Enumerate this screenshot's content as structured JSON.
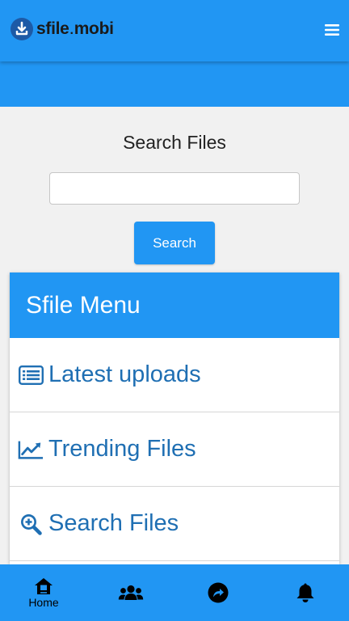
{
  "header": {
    "logo_name": "sfile",
    "logo_dot": ".",
    "logo_suffix": "mobi",
    "menu_icon": "hamburger-icon"
  },
  "search": {
    "title": "Search Files",
    "input_value": "",
    "button_label": "Search"
  },
  "menu": {
    "title": "Sfile Menu",
    "items": [
      {
        "label": "Latest uploads",
        "icon": "list-icon"
      },
      {
        "label": "Trending Files",
        "icon": "trending-chart-icon"
      },
      {
        "label": "Search Files",
        "icon": "search-plus-icon"
      }
    ]
  },
  "bottom_nav": {
    "items": [
      {
        "label": "Home",
        "icon": "home-icon"
      },
      {
        "label": "",
        "icon": "users-icon"
      },
      {
        "label": "",
        "icon": "share-arrow-icon"
      },
      {
        "label": "",
        "icon": "bell-icon"
      }
    ]
  },
  "colors": {
    "primary": "#2196f3",
    "menu_text": "#1f6fb3",
    "page_background": "#f1f1f1"
  }
}
